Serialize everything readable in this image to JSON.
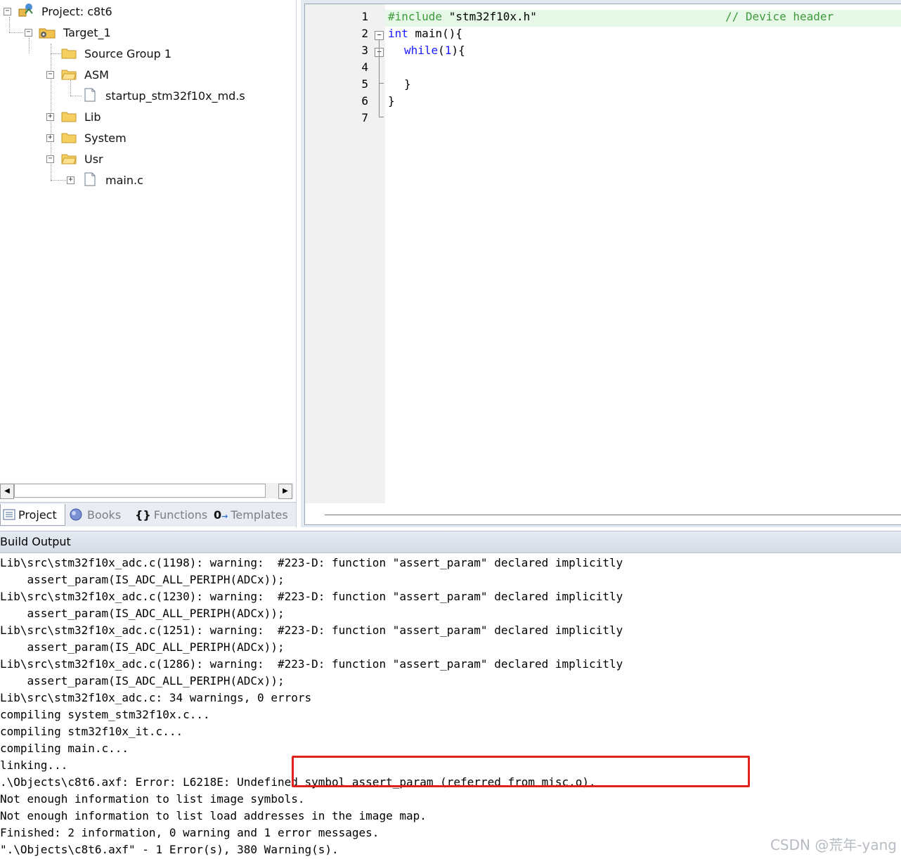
{
  "project_tree": {
    "root": "Project: c8t6",
    "target": "Target_1",
    "items": [
      {
        "label": "Source Group 1"
      },
      {
        "label": "ASM"
      },
      {
        "label": "startup_stm32f10x_md.s"
      },
      {
        "label": "Lib"
      },
      {
        "label": "System"
      },
      {
        "label": "Usr"
      },
      {
        "label": "main.c"
      }
    ]
  },
  "panel_tabs": [
    {
      "label": "Project",
      "icon": "project-icon"
    },
    {
      "label": "Books",
      "icon": "books-icon"
    },
    {
      "label": "Functions",
      "icon": "braces-icon"
    },
    {
      "label": "Templates",
      "icon": "templates-icon"
    }
  ],
  "editor": {
    "line_numbers": [
      "1",
      "2",
      "3",
      "4",
      "5",
      "6",
      "7"
    ],
    "lines": {
      "l1_directive": "#include",
      "l1_string": "\"stm32f10x.h\"",
      "l1_comment": "// Device header",
      "l2_kw": "int",
      "l2_rest": "main(){",
      "l3_kw": "while",
      "l3_open": "(",
      "l3_num": "1",
      "l3_close": "){",
      "l5": "}",
      "l6": "}"
    },
    "fold_markers": [
      "−",
      "−"
    ]
  },
  "build_output": {
    "title": "Build Output",
    "lines": [
      "Lib\\src\\stm32f10x_adc.c(1198): warning:  #223-D: function \"assert_param\" declared implicitly",
      "    assert_param(IS_ADC_ALL_PERIPH(ADCx));",
      "Lib\\src\\stm32f10x_adc.c(1230): warning:  #223-D: function \"assert_param\" declared implicitly",
      "    assert_param(IS_ADC_ALL_PERIPH(ADCx));",
      "Lib\\src\\stm32f10x_adc.c(1251): warning:  #223-D: function \"assert_param\" declared implicitly",
      "    assert_param(IS_ADC_ALL_PERIPH(ADCx));",
      "Lib\\src\\stm32f10x_adc.c(1286): warning:  #223-D: function \"assert_param\" declared implicitly",
      "    assert_param(IS_ADC_ALL_PERIPH(ADCx));",
      "Lib\\src\\stm32f10x_adc.c: 34 warnings, 0 errors",
      "compiling system_stm32f10x.c...",
      "compiling stm32f10x_it.c...",
      "compiling main.c...",
      "linking...",
      ".\\Objects\\c8t6.axf: Error: L6218E: Undefined symbol assert_param (referred from misc.o).",
      "Not enough information to list image symbols.",
      "Not enough information to list load addresses in the image map.",
      "Finished: 2 information, 0 warning and 1 error messages.",
      "\".\\Objects\\c8t6.axf\" - 1 Error(s), 380 Warning(s)."
    ]
  },
  "watermark": "CSDN @荒年-yang",
  "colors": {
    "highlight_box": "#e0211c",
    "keyword": "#1a1aff",
    "comment": "#3c9b3c",
    "current_line": "#e8f8e8"
  }
}
